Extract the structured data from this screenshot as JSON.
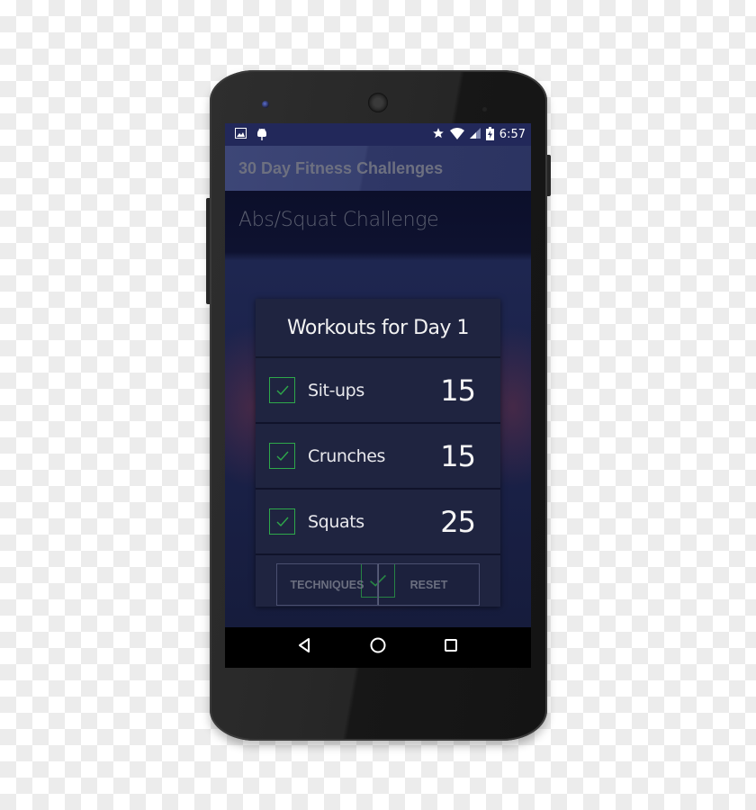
{
  "status_bar": {
    "left_icons": [
      "image-icon",
      "android-icon"
    ],
    "right_icons": [
      "star-icon",
      "wifi-icon",
      "cell-signal-icon",
      "battery-charging-icon"
    ],
    "time": "6:57"
  },
  "app_bar": {
    "title": "30 Day Fitness Challenges"
  },
  "challenge": {
    "title": "Abs/Squat Challenge"
  },
  "dialog": {
    "title": "Workouts for Day 1",
    "workouts": [
      {
        "name": "Sit-ups",
        "count": "15",
        "checked": true
      },
      {
        "name": "Crunches",
        "count": "15",
        "checked": true
      },
      {
        "name": "Squats",
        "count": "25",
        "checked": true
      }
    ],
    "confirm_icon": "check-icon"
  },
  "buttons": {
    "techniques": "TECHNIQUES",
    "reset": "RESET"
  },
  "nav_bar": {
    "icons": [
      "back-icon",
      "home-icon",
      "recents-icon"
    ]
  },
  "colors": {
    "accent_green": "#2ea84a",
    "status_bar": "#22285a",
    "dialog_bg": "#1f2440"
  }
}
